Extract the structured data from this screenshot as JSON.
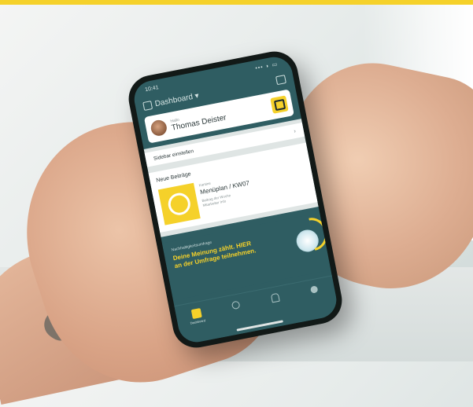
{
  "status_bar": {
    "time": "10:41",
    "icons": "••• ◗ ▭"
  },
  "header": {
    "title": "Dashboard ▾"
  },
  "profile": {
    "greeting": "Hallo",
    "name": "Thomas Deister"
  },
  "sidebar_row": {
    "label": "Sidebar einstellen",
    "chevron": "›"
  },
  "posts": {
    "section_title": "Neue Beiträge",
    "item": {
      "category": "Kantine",
      "title": "Menüplan / KW07",
      "meta_line1": "Beitrag der Woche",
      "meta_line2": "Mitarbeiter Info"
    }
  },
  "survey": {
    "kicker": "Nachhaltigkeitsumfrage",
    "text": "Deine Meinung zählt. HIER an der Umfrage teilnehmen."
  },
  "tabs": [
    {
      "label": "Dashboard",
      "icon": "dashboard-icon"
    },
    {
      "label": "",
      "icon": "search-icon"
    },
    {
      "label": "",
      "icon": "bell-icon"
    },
    {
      "label": "",
      "icon": "user-icon"
    }
  ],
  "colors": {
    "accent": "#f5d12a",
    "teal": "#2f5d62",
    "card": "#ffffff"
  }
}
